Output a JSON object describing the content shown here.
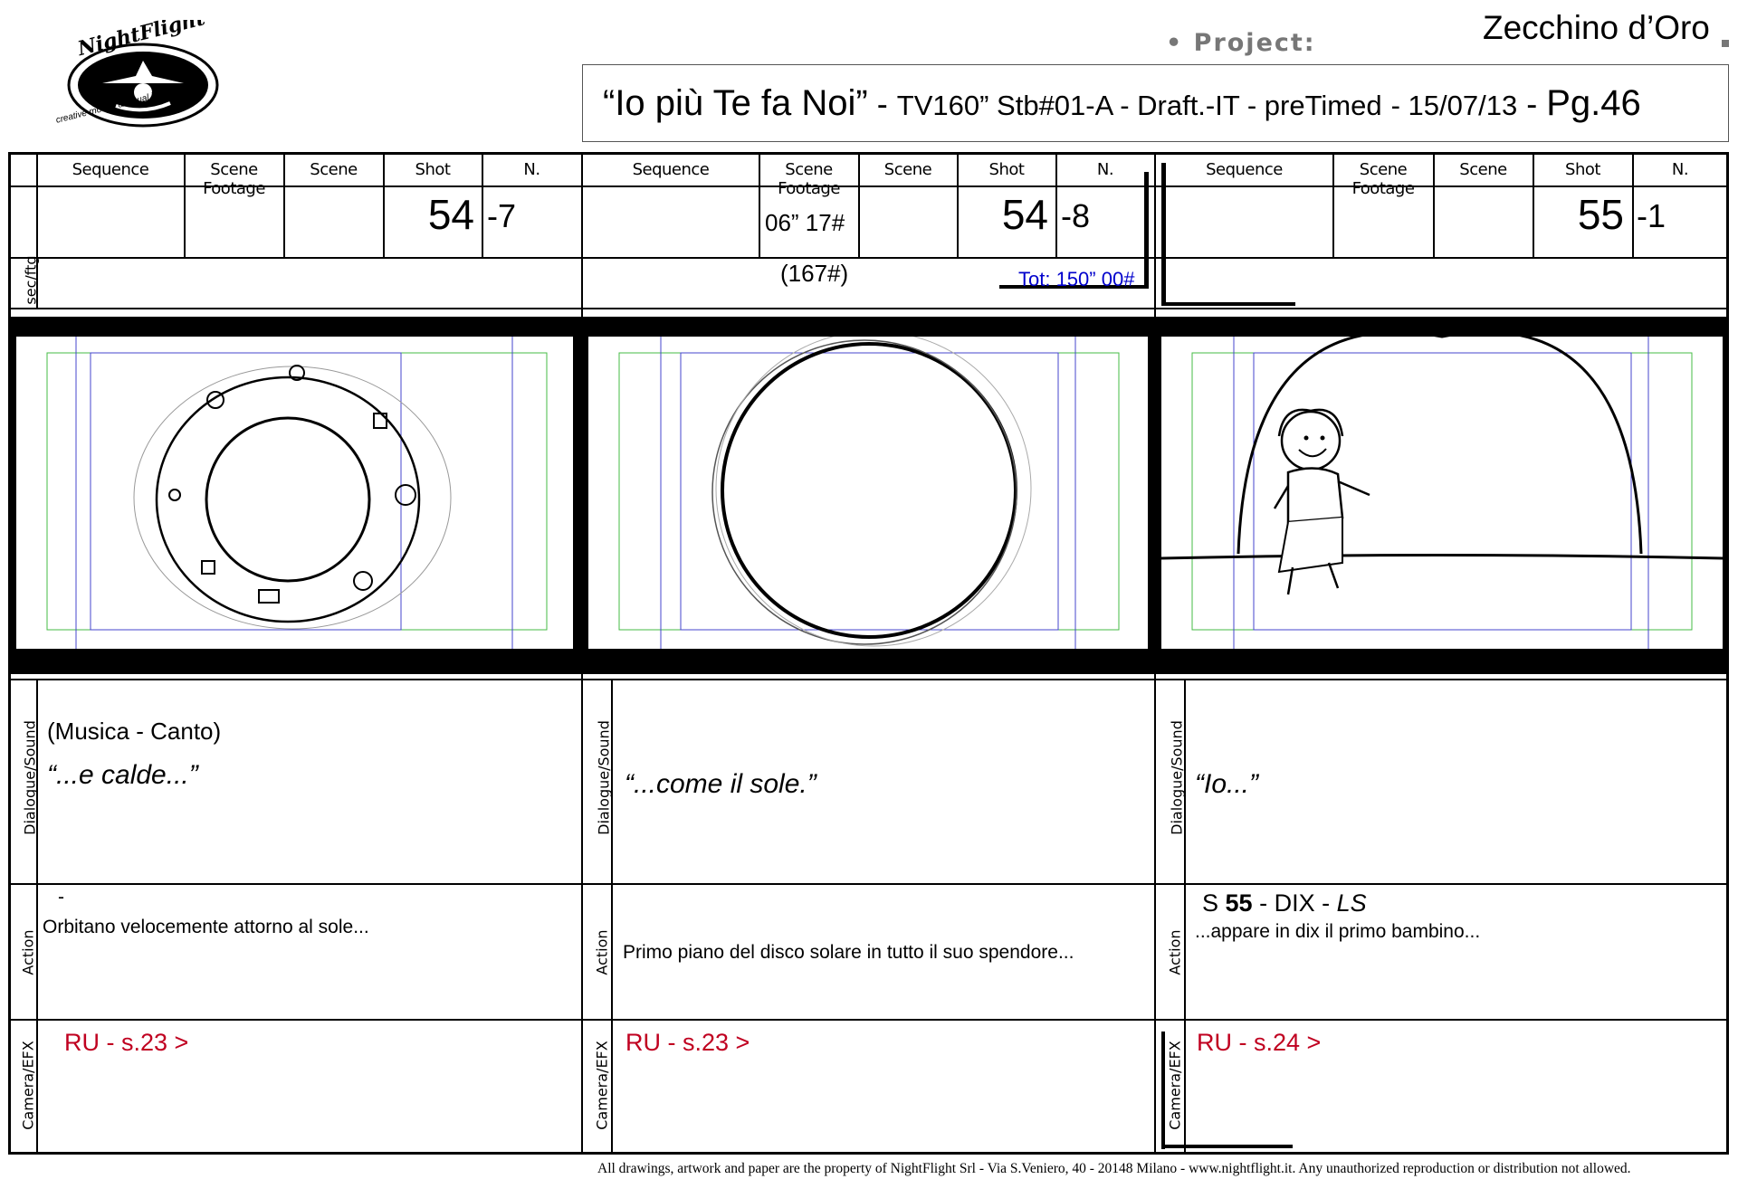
{
  "header": {
    "logo_text": "NightFlight",
    "logo_tagline": "creative motion & visual imagery",
    "project_label": "• Project:",
    "project_name": "Zecchino d’Oro",
    "title_quote": "“Io più Te fa Noi”",
    "title_sep1": "-",
    "title_details": "TV160” Stb#01-A - Draft.-IT - preTimed",
    "title_sep2": "- 15/07/13",
    "title_sep3": "-",
    "page": "Pg.46"
  },
  "labels": {
    "sequence": "Sequence",
    "scene_footage": "Scene Footage",
    "scene": "Scene",
    "shot": "Shot",
    "n": "N.",
    "secftg": "sec/ftg",
    "dialogue": "Dialogue/Sound",
    "action": "Action",
    "camera": "Camera/EFX"
  },
  "panels": [
    {
      "scene_footage": "",
      "shot": "54",
      "n": "-7",
      "footage_extra": "",
      "tot": "",
      "dialogue_line1": "(Musica - Canto)",
      "dialogue_line2": "“...e calde...”",
      "action_line1": "-",
      "action_line2": "Orbitano velocemente attorno al sole...",
      "camera": "RU - s.23 >"
    },
    {
      "scene_footage": "06” 17#",
      "shot": "54",
      "n": "-8",
      "footage_extra": "(167#)",
      "tot": "Tot: 150” 00#",
      "dialogue_line1": "",
      "dialogue_line2": "“...come il sole.”",
      "action_line1": "",
      "action_line2": "Primo piano del disco solare in tutto il suo spendore...",
      "camera": "RU - s.23 >"
    },
    {
      "scene_footage": "",
      "shot": "55",
      "n": "-1",
      "footage_extra": "",
      "tot": "",
      "dialogue_line1": "",
      "dialogue_line2": "“Io...”",
      "action_line1_pre": "S",
      "action_line1_bold": "55",
      "action_line1_mid": "- DIX -",
      "action_line1_it": "LS",
      "action_line2": "...appare in dix il primo bambino...",
      "camera": "RU - s.24 >"
    }
  ],
  "footer": "All drawings, artwork and paper are the property of NightFlight Srl - Via S.Veniero, 40 - 20148 Milano - www.nightflight.it.  Any unauthorized reproduction or distribution not allowed.",
  "colors": {
    "red": "#c00020",
    "blue": "#0000cc",
    "guide_green": "#44bb44",
    "guide_blue": "#4444cc"
  }
}
